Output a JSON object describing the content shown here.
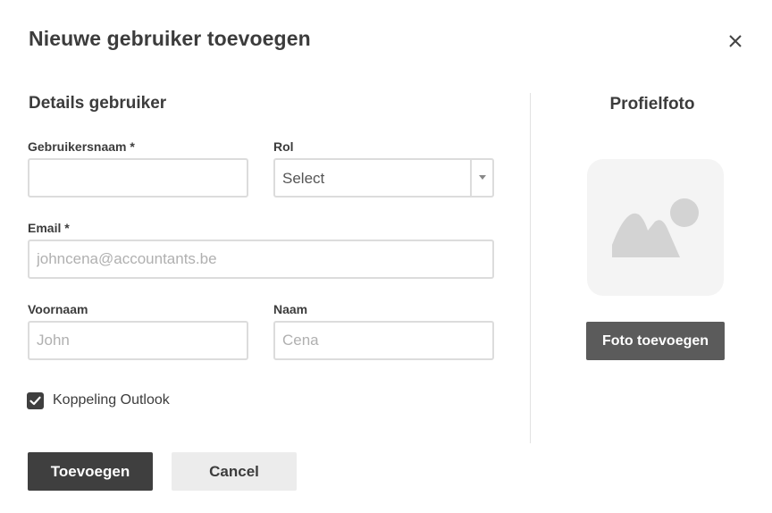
{
  "dialog": {
    "title": "Nieuwe gebruiker toevoegen",
    "close_icon": "close-icon"
  },
  "details": {
    "section_title": "Details gebruiker",
    "username": {
      "label": "Gebruikersnaam *",
      "value": "",
      "placeholder": ""
    },
    "role": {
      "label": "Rol",
      "selected": "Select",
      "icon": "chevron-down-icon"
    },
    "email": {
      "label": "Email *",
      "value": "",
      "placeholder": "johncena@accountants.be"
    },
    "firstname": {
      "label": "Voornaam",
      "value": "",
      "placeholder": "John"
    },
    "lastname": {
      "label": "Naam",
      "value": "",
      "placeholder": "Cena"
    },
    "outlook": {
      "label": "Koppeling Outlook",
      "checked": true
    }
  },
  "profile_photo": {
    "title": "Profielfoto",
    "placeholder_icon": "image-placeholder-icon",
    "add_button": "Foto toevoegen"
  },
  "actions": {
    "submit": "Toevoegen",
    "cancel": "Cancel"
  },
  "colors": {
    "primary_button": "#3f3f3f",
    "secondary_button": "#ececec",
    "photo_button": "#5b5b5b",
    "input_border": "#dcdcdc"
  }
}
